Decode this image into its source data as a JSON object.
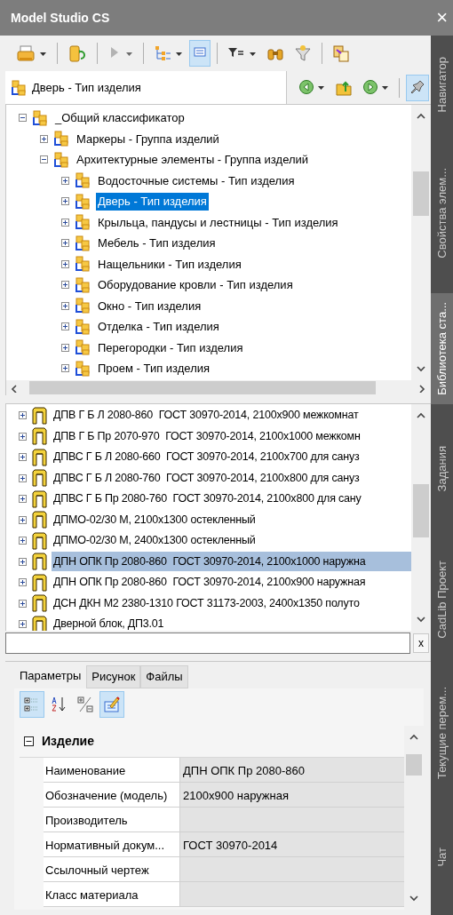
{
  "window": {
    "title": "Model Studio CS",
    "close": "×"
  },
  "toolbar": [
    {
      "kind": "printer",
      "dropdown": true,
      "pressed": false,
      "disabled": false
    },
    {
      "kind": "database-refresh",
      "dropdown": false,
      "pressed": false,
      "disabled": false
    },
    {
      "kind": "play",
      "dropdown": true,
      "pressed": false,
      "disabled": true
    },
    {
      "kind": "tree-view",
      "dropdown": true,
      "pressed": false,
      "disabled": false
    },
    {
      "kind": "list-view",
      "dropdown": false,
      "pressed": true,
      "disabled": false
    },
    {
      "kind": "filter-list",
      "dropdown": true,
      "pressed": false,
      "disabled": false
    },
    {
      "kind": "binoculars",
      "dropdown": false,
      "pressed": false,
      "disabled": false
    },
    {
      "kind": "funnel",
      "dropdown": false,
      "pressed": false,
      "disabled": false
    },
    {
      "kind": "copy",
      "dropdown": false,
      "pressed": false,
      "disabled": false
    }
  ],
  "address": {
    "path": "Дверь - Тип изделия"
  },
  "navigation": [
    {
      "kind": "back",
      "dropdown": true,
      "pressed": false
    },
    {
      "kind": "up",
      "dropdown": false,
      "pressed": false
    },
    {
      "kind": "forward",
      "dropdown": true,
      "pressed": false
    },
    {
      "kind": "pin",
      "dropdown": false,
      "pressed": true
    }
  ],
  "tree": [
    {
      "label": "_Общий классификатор",
      "expanded": true,
      "selected": false,
      "children": [
        {
          "label": "Маркеры - Группа изделий",
          "expanded": false,
          "selected": false
        },
        {
          "label": "Архитектурные элементы - Группа изделий",
          "expanded": true,
          "selected": false,
          "children": [
            {
              "label": "Водосточные системы - Тип изделия",
              "expanded": false,
              "selected": false
            },
            {
              "label": "Дверь - Тип изделия",
              "expanded": false,
              "selected": true
            },
            {
              "label": "Крыльца, пандусы и лестницы - Тип изделия",
              "expanded": false,
              "selected": false
            },
            {
              "label": "Мебель - Тип изделия",
              "expanded": false,
              "selected": false
            },
            {
              "label": "Нащельники - Тип изделия",
              "expanded": false,
              "selected": false
            },
            {
              "label": "Оборудование кровли - Тип изделия",
              "expanded": false,
              "selected": false
            },
            {
              "label": "Окно - Тип изделия",
              "expanded": false,
              "selected": false
            },
            {
              "label": "Отделка - Тип изделия",
              "expanded": false,
              "selected": false
            },
            {
              "label": "Перегородки - Тип изделия",
              "expanded": false,
              "selected": false
            },
            {
              "label": "Проем - Тип изделия",
              "expanded": false,
              "selected": false
            }
          ]
        }
      ]
    }
  ],
  "items": [
    {
      "label": "ДПВ Г Б Л 2080-860  ГОСТ 30970-2014, 2100x900 межкомнат",
      "selected": false
    },
    {
      "label": "ДПВ Г Б Пр 2070-970  ГОСТ 30970-2014, 2100x1000 межкомн",
      "selected": false
    },
    {
      "label": "ДПВС Г Б Л 2080-660  ГОСТ 30970-2014, 2100x700 для сануз",
      "selected": false
    },
    {
      "label": "ДПВС Г Б Л 2080-760  ГОСТ 30970-2014, 2100x800 для сануз",
      "selected": false
    },
    {
      "label": "ДПВС Г Б Пр 2080-760  ГОСТ 30970-2014, 2100x800 для сану",
      "selected": false
    },
    {
      "label": "ДПМО-02/30 М, 2100x1300 остекленный",
      "selected": false
    },
    {
      "label": "ДПМО-02/30 М, 2400x1300 остекленный",
      "selected": false
    },
    {
      "label": "ДПН ОПК Пр 2080-860  ГОСТ 30970-2014, 2100x1000 наружна",
      "selected": true
    },
    {
      "label": "ДПН ОПК Пр 2080-860  ГОСТ 30970-2014, 2100x900 наружная",
      "selected": false
    },
    {
      "label": "ДСН ДКН М2 2380-1310 ГОСТ 31173-2003, 2400x1350 полуто",
      "selected": false
    },
    {
      "label": "Дверной блок, ДП3.01",
      "selected": false
    }
  ],
  "search": {
    "clear": "x"
  },
  "tabs": [
    {
      "label": "Параметры",
      "selected": true
    },
    {
      "label": "Рисунок",
      "selected": false
    },
    {
      "label": "Файлы",
      "selected": false
    }
  ],
  "property_toolbar": [
    {
      "kind": "categorized",
      "pressed": true
    },
    {
      "kind": "alphabetical",
      "pressed": false
    },
    {
      "kind": "expand-collapse",
      "pressed": false
    },
    {
      "kind": "edit",
      "pressed": true
    }
  ],
  "properties": {
    "category": "Изделие",
    "expanded": true,
    "rows": [
      {
        "name": "Наименование",
        "value": "ДПН ОПК Пр 2080-860"
      },
      {
        "name": "Обозначение (модель)",
        "value": "2100x900 наружная"
      },
      {
        "name": "Производитель"
      },
      {
        "name": "Нормативный докум...",
        "value": "ГОСТ 30970-2014"
      },
      {
        "name": "Ссылочный чертеж"
      },
      {
        "name": "Класс материала"
      }
    ]
  },
  "side_tabs": [
    {
      "label": "Навигатор",
      "selected": false
    },
    {
      "label": "Свойства элем...",
      "selected": false
    },
    {
      "label": "Библиотека ста...",
      "selected": true
    },
    {
      "label": "Задания",
      "selected": false
    },
    {
      "label": "CadLib Проект",
      "selected": false
    },
    {
      "label": "Текущие перем...",
      "selected": false
    },
    {
      "label": "Чат",
      "selected": false
    }
  ]
}
